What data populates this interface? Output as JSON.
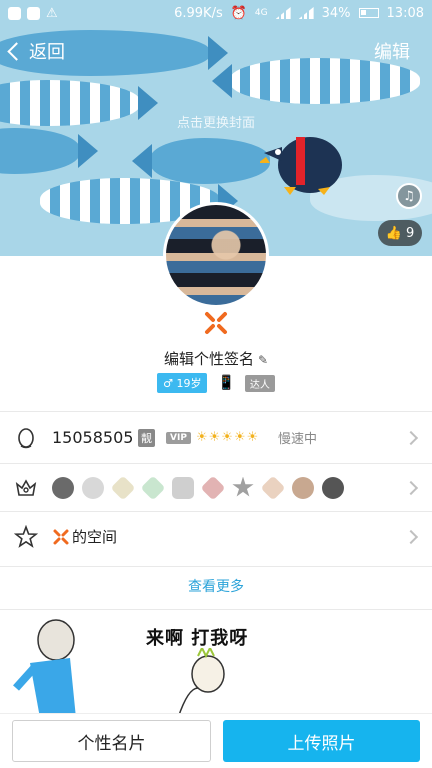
{
  "status_bar": {
    "speed": "6.99K/s",
    "network": "4G",
    "battery": "34%",
    "time": "13:08"
  },
  "nav": {
    "back_label": "返回",
    "edit_label": "编辑"
  },
  "cover": {
    "hint": "点击更换封面",
    "like_count": "9"
  },
  "profile": {
    "signature": "编辑个性签名",
    "age_tag": "19岁",
    "master_tag": "达人"
  },
  "qq_row": {
    "number": "15058505",
    "liang": "靓",
    "vip": "VIP",
    "suns": "☀☀☀☀☀",
    "status": "慢速中"
  },
  "space_row": {
    "label": "的空间"
  },
  "see_more": "查看更多",
  "photo": {
    "caption": "来啊 打我呀"
  },
  "bottom": {
    "card_label": "个性名片",
    "upload_label": "上传照片"
  },
  "colors": {
    "accent": "#16b4ee",
    "link": "#2ba3d9",
    "cover_bg": "#a9d6e8"
  }
}
